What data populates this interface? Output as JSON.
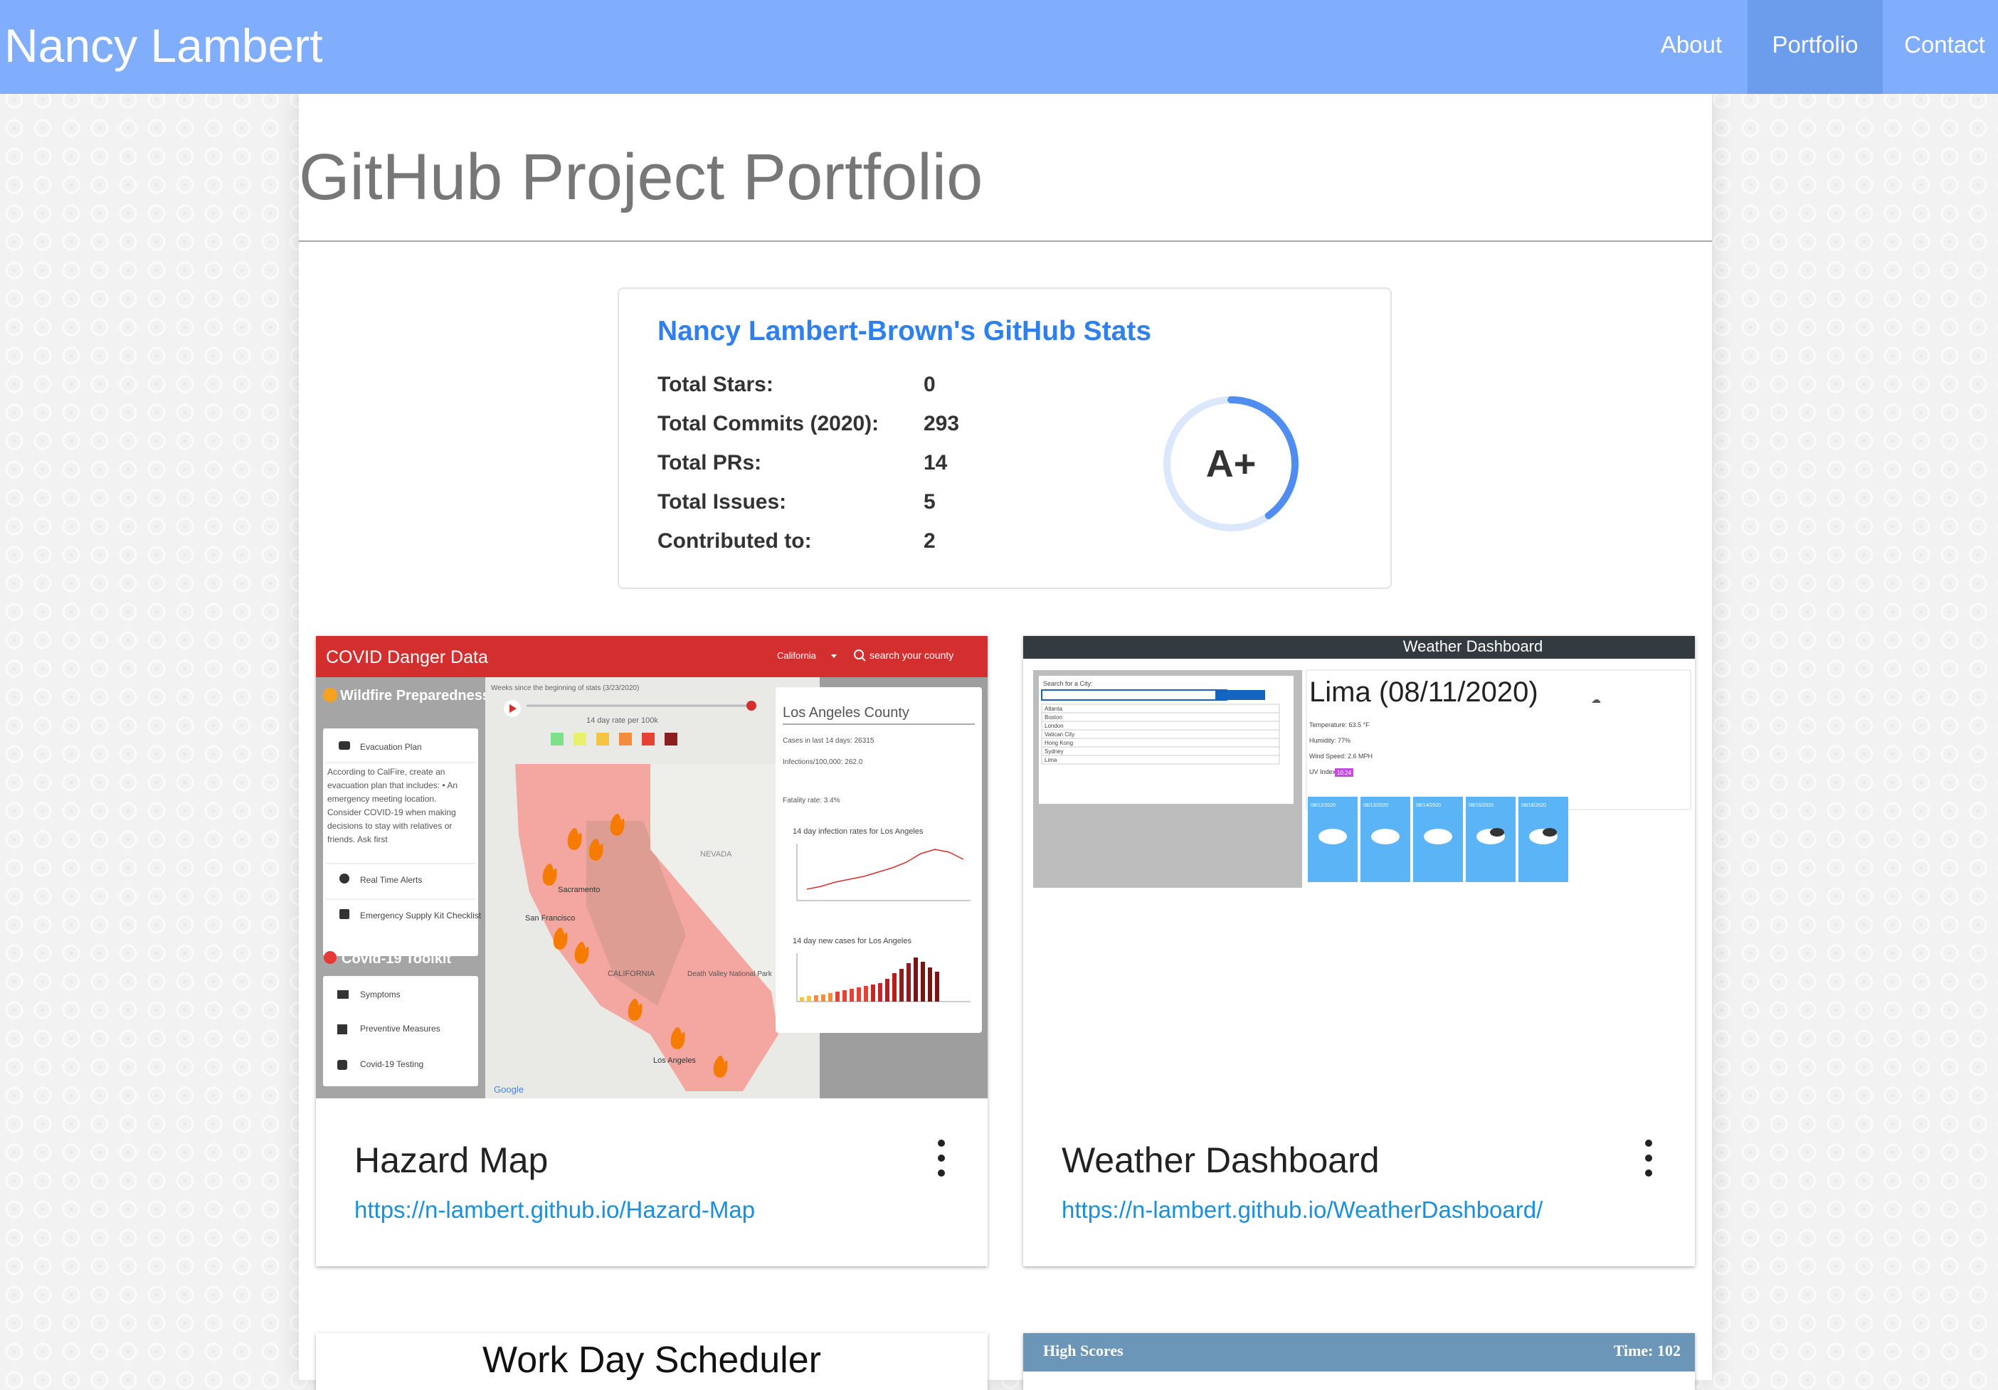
{
  "nav": {
    "brand": "Nancy Lambert",
    "items": [
      {
        "label": "About",
        "active": false
      },
      {
        "label": "Portfolio",
        "active": true
      },
      {
        "label": "Contact",
        "active": false
      }
    ]
  },
  "page": {
    "title": "GitHub Project Portfolio"
  },
  "stats": {
    "title": "Nancy Lambert-Brown's GitHub Stats",
    "rows": [
      {
        "label": "Total Stars:",
        "value": "0"
      },
      {
        "label": "Total Commits (2020):",
        "value": "293"
      },
      {
        "label": "Total PRs:",
        "value": "14"
      },
      {
        "label": "Total Issues:",
        "value": "5"
      },
      {
        "label": "Contributed to:",
        "value": "2"
      }
    ],
    "rank": "A+",
    "rank_progress": 0.4
  },
  "projects": [
    {
      "title": "Hazard Map",
      "link": "https://n-lambert.github.io/Hazard-Map",
      "thumb": {
        "header": "COVID Danger Data",
        "state_select": "California",
        "search": "search your county",
        "sidebar_title": "Wildfire Preparedness",
        "sidebar_items": [
          "Evacuation Plan",
          "Real Time Alerts",
          "Emergency Supply Kit Checklist"
        ],
        "sidebar_text": "According to CalFire, create an evacuation plan that includes: • An emergency meeting location. Consider COVID-19 when making decisions to stay with relatives or friends. Ask first",
        "toolkit_title": "Covid-19 Toolkit",
        "toolkit_items": [
          "Symptoms",
          "Preventive Measures",
          "Covid-19 Testing"
        ],
        "timeline_label": "Weeks since the beginning of stats (3/23/2020)",
        "legend_title": "14 day rate per 100k",
        "county_title": "Los Angeles County",
        "county_lines": [
          "Cases in last 14 days: 26315",
          "Infections/100,000: 262.0",
          "Fatality rate: 3.4%"
        ],
        "chart1_title": "14 day infection rates for Los Angeles",
        "chart2_title": "14 day new cases for Los Angeles",
        "map_labels": [
          "NEVADA",
          "Sacramento",
          "San Francisco",
          "CALIFORNIA",
          "Los Angeles",
          "Death Valley National Park"
        ],
        "google": "Google"
      }
    },
    {
      "title": "Weather Dashboard",
      "link": "https://n-lambert.github.io/WeatherDashboard/",
      "thumb": {
        "header": "Weather Dashboard",
        "search_label": "Search for a City:",
        "cities": [
          "Atlanta",
          "Boston",
          "London",
          "Vatican City",
          "Hong Kong",
          "Sydney",
          "Lima"
        ],
        "city_heading": "Lima (08/11/2020)",
        "details": [
          "Temperature: 63.5 °F",
          "Humidity: 77%",
          "Wind Speed: 2.6 MPH",
          "UV Index:"
        ],
        "uv": "10.24",
        "forecast_dates": [
          "08/12/2020",
          "08/13/2020",
          "08/14/2020",
          "08/15/2020",
          "08/16/2020"
        ]
      }
    },
    {
      "title": "Work Day Scheduler"
    },
    {
      "thumb_header": "High Scores",
      "thumb_time": "Time: 102"
    }
  ],
  "colors": {
    "navbar": "#80aefc",
    "nav_active": "#6c9cec",
    "stats_title": "#2f80ed",
    "link": "#1a8fdc",
    "covid_header": "#d32f2f",
    "weather_header": "#333a40",
    "forecast_tile": "#5ab4f5",
    "highscores_bar": "#6b96b8"
  }
}
